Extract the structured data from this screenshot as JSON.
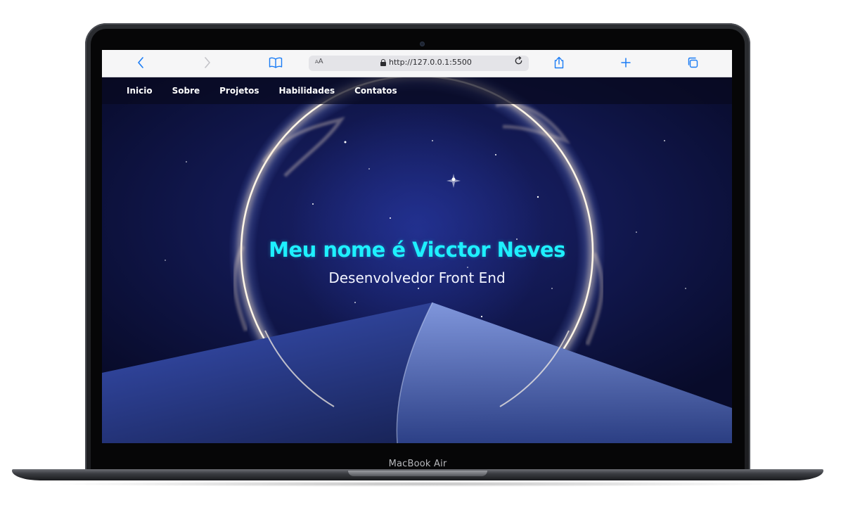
{
  "device": {
    "label": "MacBook Air"
  },
  "browser": {
    "nav": {
      "back_icon": "chevron-left-icon",
      "forward_icon": "chevron-right-icon",
      "bookmarks_icon": "book-icon",
      "share_icon": "share-icon",
      "new_tab_icon": "plus-icon",
      "tabs_icon": "tabs-icon"
    },
    "address_bar": {
      "reader_label_small": "A",
      "reader_label_large": "A",
      "url": "http://127.0.0.1:5500",
      "reload_icon": "reload-icon"
    },
    "accent_color": "#1a7cf5"
  },
  "site": {
    "navbar": {
      "items": [
        {
          "label": "Inicio"
        },
        {
          "label": "Sobre"
        },
        {
          "label": "Projetos"
        },
        {
          "label": "Habilidades"
        },
        {
          "label": "Contatos"
        }
      ]
    },
    "hero": {
      "title": "Meu nome é Vicctor Neves",
      "subtitle": "Desenvolvedor Front End",
      "title_color": "#1ef0ff"
    }
  }
}
